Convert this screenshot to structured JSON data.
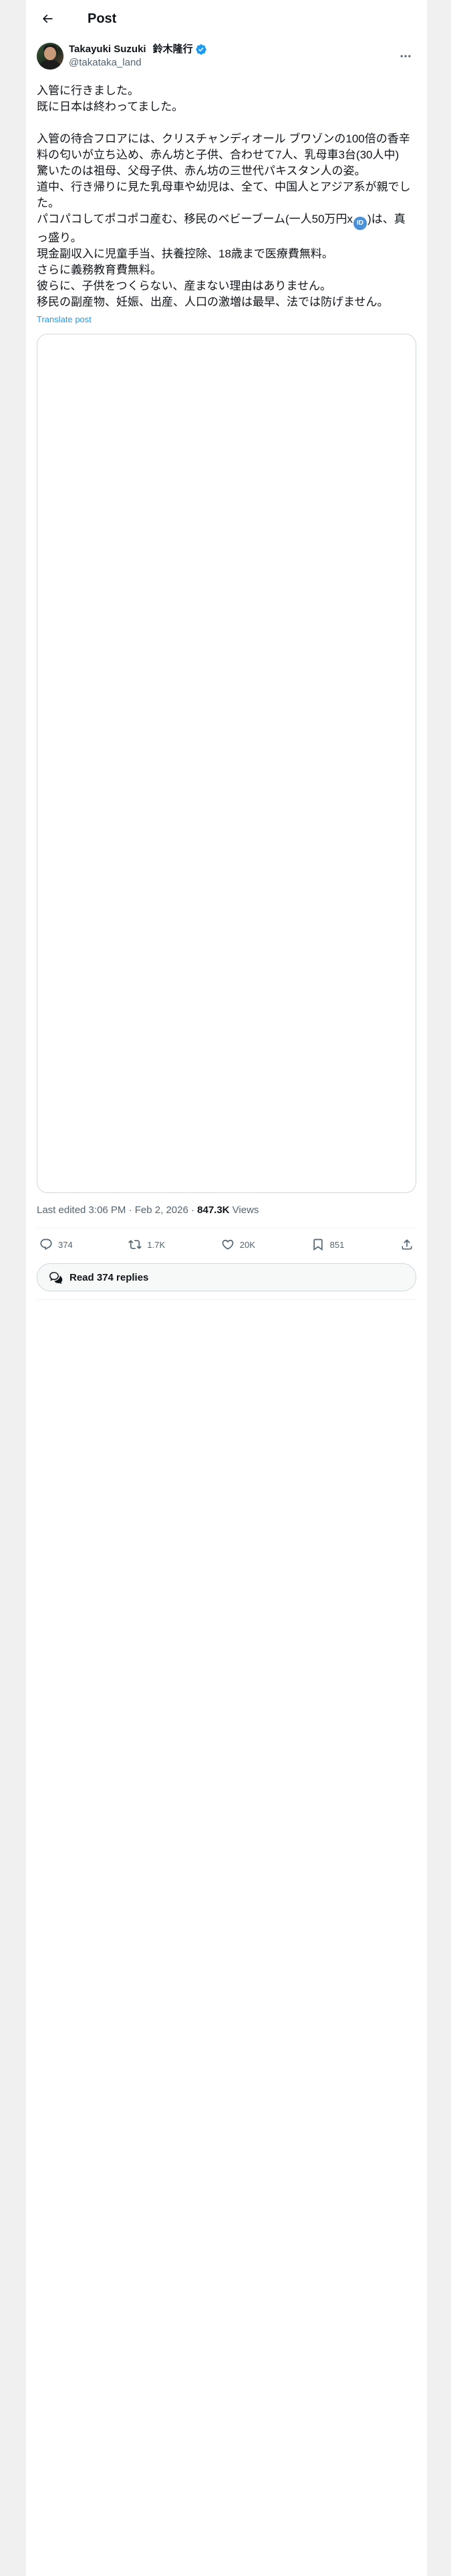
{
  "header": {
    "title": "Post"
  },
  "author": {
    "display_name": "Takayuki Suzuki",
    "japanese_name": "鈴木隆行",
    "handle": "@takataka_land",
    "verified_color": "#1d9bf0"
  },
  "post": {
    "lines": [
      "入管に行きました。",
      "既に日本は終わってました。",
      "",
      "入管の待合フロアには、クリスチャンディオール ブワゾンの100倍の香辛料の匂いが立ち込め、赤ん坊と子供、合わせて7人、乳母車3台(30人中)",
      "驚いたのは祖母、父母子供、赤ん坊の三世代パキスタン人の姿。",
      "道中、行き帰りに見た乳母車や幼児は、全て、中国人とアジア系が親でした。",
      "パコパコしてポコポコ産む、移民のベビーブーム(一人50万円x",
      ")は、真っ盛り。",
      "現金副収入に児童手当、扶養控除、18歳まで医療費無料。",
      "さらに義務教育費無料。",
      "彼らに、子供をつくらない、産まない理由はありません。",
      "移民の副産物、妊娠、出産、人口の激増は最早、法では防げません。"
    ],
    "emoji_label": "ID",
    "translate_label": "Translate post"
  },
  "meta": {
    "edited": "Last edited 3:06 PM · Feb 2, 2026 · ",
    "views_count": "847.3K",
    "views_label": " Views"
  },
  "actions": {
    "replies": "374",
    "reposts": "1.7K",
    "likes": "20K",
    "bookmarks": "851"
  },
  "replies_button": {
    "label": "Read 374 replies"
  },
  "icons": {
    "back": "back-arrow-icon",
    "more": "more-dots-icon",
    "verified": "verified-badge-icon",
    "reply": "reply-icon",
    "repost": "repost-icon",
    "like": "heart-icon",
    "bookmark": "bookmark-icon",
    "share": "share-icon",
    "replies": "chat-bubbles-icon"
  }
}
